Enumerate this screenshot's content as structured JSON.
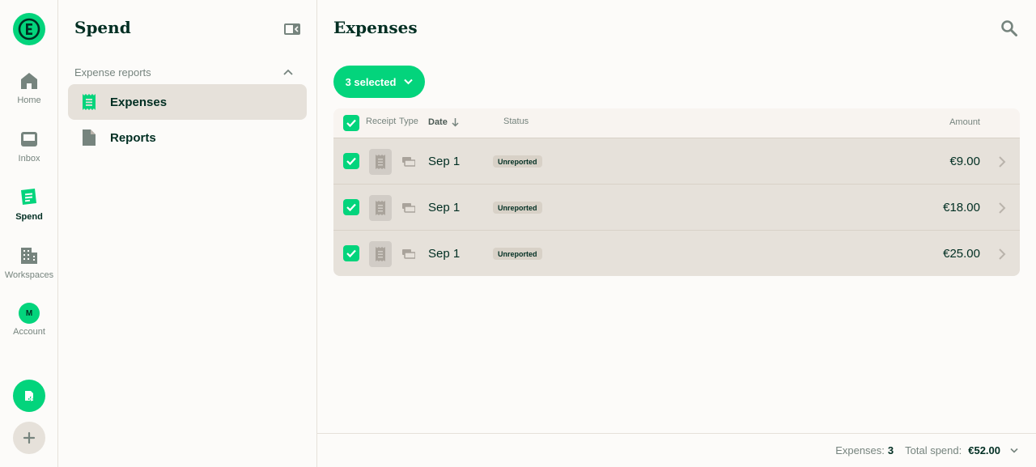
{
  "colors": {
    "accent": "#03d47c",
    "text_dark": "#002e22",
    "text_muted": "#76847e",
    "row_bg": "#e6e1da",
    "badge_bg": "#d8d1c7"
  },
  "rail": {
    "logo_letter": "E",
    "items": [
      {
        "label": "Home",
        "icon": "home-icon"
      },
      {
        "label": "Inbox",
        "icon": "inbox-icon"
      },
      {
        "label": "Spend",
        "icon": "receipt-icon"
      },
      {
        "label": "Workspaces",
        "icon": "building-icon"
      },
      {
        "label": "Account",
        "icon": "avatar",
        "avatar_initial": "M"
      }
    ],
    "create_icon": "new-expense-icon",
    "add_icon": "plus-icon"
  },
  "sidebar": {
    "title": "Spend",
    "section_label": "Expense reports",
    "items": [
      {
        "label": "Expenses",
        "icon": "receipt-icon",
        "active": true
      },
      {
        "label": "Reports",
        "icon": "document-icon",
        "active": false
      }
    ]
  },
  "main": {
    "title": "Expenses",
    "selected_button": "3 selected",
    "columns": {
      "receipt": "Receipt",
      "type": "Type",
      "date": "Date",
      "status": "Status",
      "amount": "Amount"
    },
    "rows": [
      {
        "date": "Sep 1",
        "status": "Unreported",
        "amount": "€9.00",
        "checked": true
      },
      {
        "date": "Sep 1",
        "status": "Unreported",
        "amount": "€18.00",
        "checked": true
      },
      {
        "date": "Sep 1",
        "status": "Unreported",
        "amount": "€25.00",
        "checked": true
      }
    ]
  },
  "footer": {
    "expenses_label": "Expenses:",
    "expenses_count": "3",
    "total_label": "Total spend:",
    "total_value": "€52.00"
  }
}
